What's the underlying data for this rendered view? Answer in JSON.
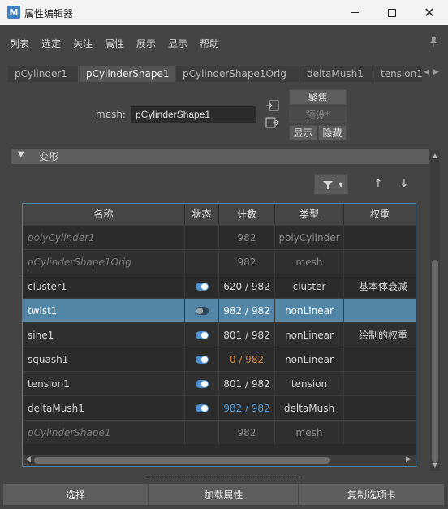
{
  "window": {
    "title": "属性编辑器",
    "icon_name": "maya-app-icon"
  },
  "menu": [
    "列表",
    "选定",
    "关注",
    "属性",
    "展示",
    "显示",
    "帮助"
  ],
  "tabs": [
    "pCylinder1",
    "pCylinderShape1",
    "pCylinderShape1Orig",
    "deltaMush1",
    "tension1"
  ],
  "active_tab": "pCylinderShape1",
  "mesh": {
    "label": "mesh:",
    "value": "pCylinderShape1"
  },
  "buttons": {
    "focus": "聚焦",
    "preset": "预设*",
    "show": "显示",
    "hide": "隐藏"
  },
  "section": {
    "title": "变形"
  },
  "table": {
    "headers": [
      "名称",
      "状态",
      "计数",
      "类型",
      "权重"
    ],
    "rows": [
      {
        "name": "polyCylinder1",
        "status": "",
        "count": "982",
        "type": "polyCylinder",
        "weight": ""
      },
      {
        "name": "pCylinderShape1Orig",
        "status": "",
        "count": "982",
        "type": "mesh",
        "weight": ""
      },
      {
        "name": "cluster1",
        "status": "on",
        "count": "620 / 982",
        "type": "cluster",
        "weight": "基本体衰减"
      },
      {
        "name": "twist1",
        "status": "off",
        "count": "982 / 982",
        "type": "nonLinear",
        "weight": ""
      },
      {
        "name": "sine1",
        "status": "on",
        "count": "801 / 982",
        "type": "nonLinear",
        "weight": "绘制的权重"
      },
      {
        "name": "squash1",
        "status": "on",
        "count": "0 / 982",
        "type": "nonLinear",
        "weight": ""
      },
      {
        "name": "tension1",
        "status": "on",
        "count": "801 / 982",
        "type": "tension",
        "weight": ""
      },
      {
        "name": "deltaMush1",
        "status": "on",
        "count": "982 / 982",
        "type": "deltaMush",
        "weight": ""
      },
      {
        "name": "pCylinderShape1",
        "status": "",
        "count": "982",
        "type": "mesh",
        "weight": ""
      }
    ]
  },
  "colors": {
    "selected_row": "#5285a6",
    "toggle_on": "#4d8fd0",
    "count_warning": "#d08a3a",
    "count_link": "#4d9ad6"
  },
  "footer": {
    "select": "选择",
    "load_attributes": "加载属性",
    "copy_tab": "复制选项卡"
  }
}
